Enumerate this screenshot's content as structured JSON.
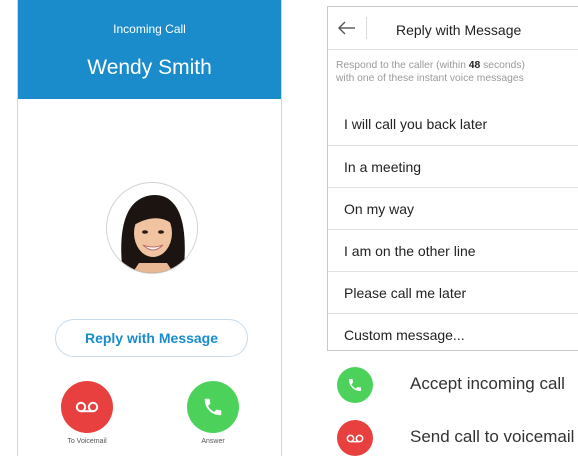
{
  "incoming_call": {
    "status_label": "Incoming Call",
    "caller_name": "Wendy Smith",
    "reply_button_label": "Reply with Message",
    "voicemail_caption": "To Voicemail",
    "answer_caption": "Answer"
  },
  "reply_screen": {
    "title": "Reply with Message",
    "instructions_prefix": "Respond to the caller (within ",
    "seconds_remaining": "48",
    "instructions_suffix": " seconds)",
    "instructions_line2": "with one of these instant voice messages",
    "messages": [
      "I will call you back later",
      "In a meeting",
      "On my way",
      "I am on the other line",
      "Please call me later",
      "Custom message..."
    ]
  },
  "legend": {
    "accept_label": "Accept incoming call",
    "voicemail_label": "Send call to voicemail"
  },
  "icons": {
    "voicemail": "voicemail-icon",
    "phone": "phone-icon",
    "back": "back-arrow-icon",
    "avatar": "person-photo"
  },
  "colors": {
    "header_blue": "#1a8ccc",
    "decline_red": "#e8403f",
    "answer_green": "#4cd25b"
  }
}
